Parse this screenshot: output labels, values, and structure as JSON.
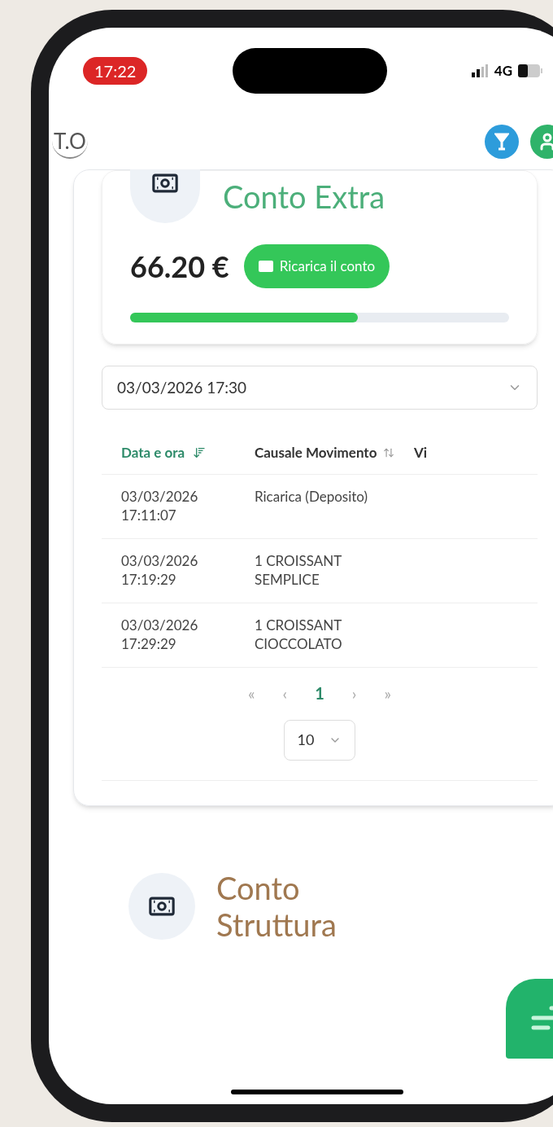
{
  "status_bar": {
    "time": "17:22",
    "network": "4G"
  },
  "header": {
    "logo": "T.O"
  },
  "account": {
    "title": "Conto Extra",
    "balance": "66.20 €",
    "recharge_button": "Ricarica il conto",
    "level": 0.6
  },
  "date_filter": {
    "value": "03/03/2026 17:30"
  },
  "table": {
    "columns": [
      {
        "label": "Data e ora",
        "sorted": true
      },
      {
        "label": "Causale Movimento",
        "sorted": false
      },
      {
        "label": "Vi",
        "sorted": false
      }
    ],
    "rows": [
      {
        "date": "03/03/2026 17:11:07",
        "description": "Ricarica (Deposito)"
      },
      {
        "date": "03/03/2026 17:19:29",
        "description": "1 CROISSANT SEMPLICE"
      },
      {
        "date": "03/03/2026 17:29:29",
        "description": "1 CROISSANT CIOCCOLATO"
      }
    ]
  },
  "pagination": {
    "first": "«",
    "prev": "‹",
    "pages": [
      {
        "label": "1",
        "selected": true
      }
    ],
    "next": "›",
    "last": "»",
    "page_size": "10"
  },
  "second_account": {
    "title": "Conto Struttura"
  }
}
